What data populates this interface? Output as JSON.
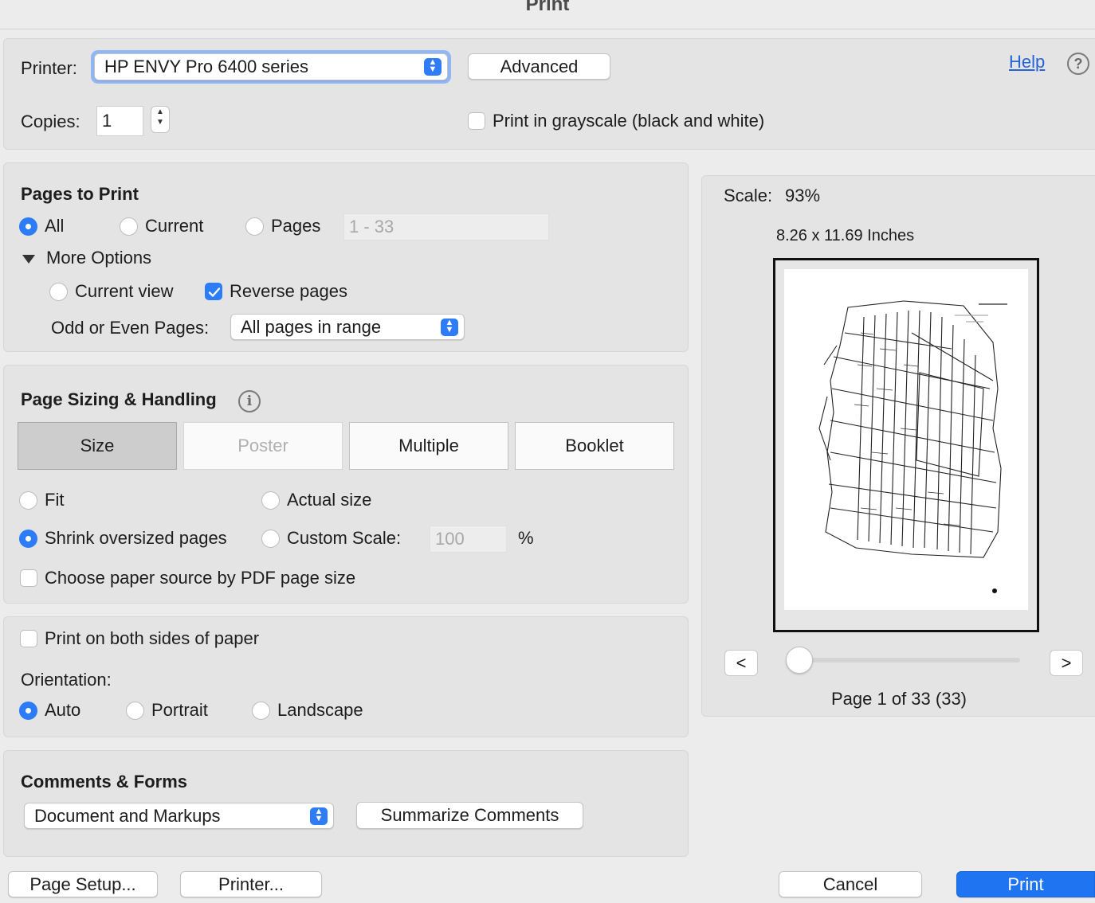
{
  "window": {
    "title": "Print"
  },
  "printer": {
    "label": "Printer:",
    "selected": "HP ENVY Pro 6400 series",
    "advanced_button": "Advanced",
    "help_link": "Help",
    "help_icon": "?",
    "copies_label": "Copies:",
    "copies_value": "1",
    "grayscale_label": "Print in grayscale (black and white)",
    "grayscale_checked": false
  },
  "pages_to_print": {
    "heading": "Pages to Print",
    "options": [
      "All",
      "Current",
      "Pages"
    ],
    "selected": "All",
    "pages_range_value": "1 - 33",
    "more_options_label": "More Options",
    "current_view_label": "Current view",
    "reverse_pages_label": "Reverse pages",
    "reverse_pages_checked": true,
    "odd_even_label": "Odd or Even Pages:",
    "odd_even_selected": "All pages in range"
  },
  "sizing": {
    "heading": "Page Sizing & Handling",
    "info_icon": "i",
    "tabs": [
      "Size",
      "Poster",
      "Multiple",
      "Booklet"
    ],
    "selected_tab": "Size",
    "fit_label": "Fit",
    "actual_size_label": "Actual size",
    "shrink_label": "Shrink oversized pages",
    "custom_scale_label": "Custom Scale:",
    "custom_scale_value": "100",
    "percent_sign": "%",
    "paper_source_label": "Choose paper source by PDF page size",
    "selected_option": "Shrink oversized pages"
  },
  "duplex": {
    "both_sides_label": "Print on both sides of paper",
    "orientation_label": "Orientation:",
    "orientation_options": [
      "Auto",
      "Portrait",
      "Landscape"
    ],
    "orientation_selected": "Auto"
  },
  "comments": {
    "heading": "Comments & Forms",
    "selected": "Document and Markups",
    "summarize_button": "Summarize Comments"
  },
  "preview": {
    "scale_label": "Scale:",
    "scale_value": "93%",
    "paper_size": "8.26 x 11.69 Inches",
    "prev_button": "<",
    "next_button": ">",
    "page_status": "Page 1 of 33 (33)",
    "slider_position_fraction": 0
  },
  "footer": {
    "page_setup_button": "Page Setup...",
    "printer_button": "Printer...",
    "cancel_button": "Cancel",
    "print_button": "Print"
  },
  "colors": {
    "accent": "#2b7cf6",
    "print_button": "#1f74f2",
    "link": "#2563d6"
  }
}
